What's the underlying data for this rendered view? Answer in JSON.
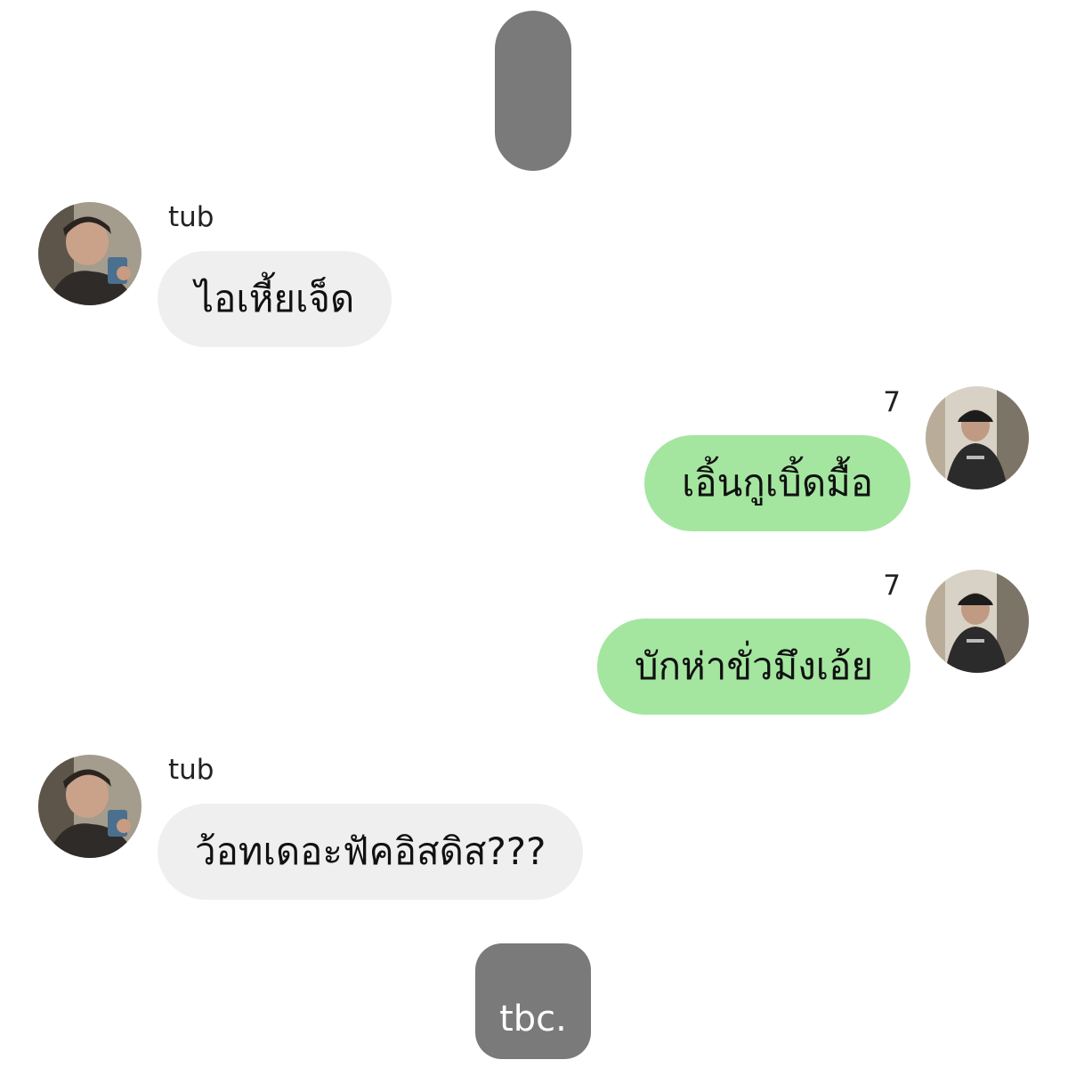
{
  "colors": {
    "received_bubble": "#efefef",
    "sent_bubble": "#a4e6a0",
    "divider_pill": "#7a7a7a"
  },
  "messages": [
    {
      "sender": "tub",
      "text": "ไอเหี้ยเจ็ด",
      "side": "left",
      "avatar_icon": "user-avatar-tub"
    },
    {
      "sender": "7",
      "text": "เอิ้นกูเบิ้ดมื้อ",
      "side": "right",
      "avatar_icon": "user-avatar-7"
    },
    {
      "sender": "7",
      "text": "บักห่าขั่วมึงเอ้ย",
      "side": "right",
      "avatar_icon": "user-avatar-7"
    },
    {
      "sender": "tub",
      "text": "ว้อทเดอะฟัคอิสดิส???",
      "side": "left",
      "avatar_icon": "user-avatar-tub"
    }
  ],
  "footer": {
    "label": "tbc."
  }
}
